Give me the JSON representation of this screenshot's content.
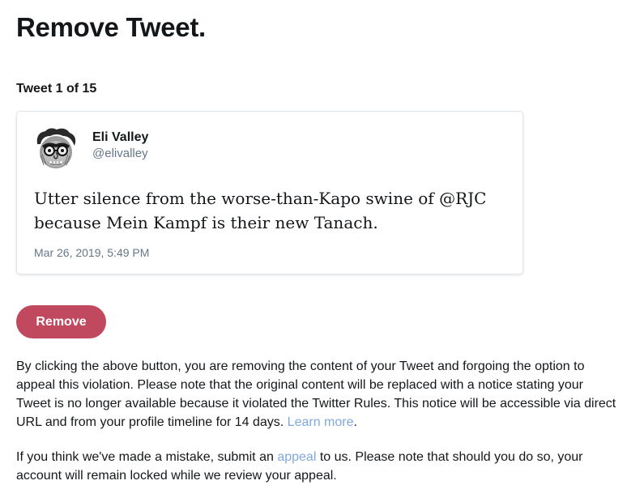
{
  "page": {
    "title": "Remove Tweet.",
    "counter": "Tweet 1 of 15"
  },
  "tweet": {
    "author_name": "Eli Valley",
    "author_handle": "@elivalley",
    "text_line1": "Utter silence from the worse-than-Kapo swine of @RJC",
    "text_line2": "because Mein Kampf is their new Tanach.",
    "date": "Mar 26, 2019, 5:49 PM",
    "avatar_icon": "caricature-avatar"
  },
  "actions": {
    "remove_label": "Remove",
    "accent_color": "#c0485f",
    "link_color": "#80a8e0"
  },
  "notice": {
    "para1_text": "By clicking the above button, you are removing the content of your Tweet and forgoing the option to appeal this violation. Please note that the original content will be replaced with a notice stating your Tweet is no longer available because it violated the Twitter Rules. This notice will be accessible via direct URL and from your profile timeline for 14 days.",
    "learn_more": "Learn more",
    "para1_end": ".",
    "para2_start": "If you think we've made a mistake, submit an",
    "appeal_link": "appeal",
    "para2_end": "to us. Please note that should you do so, your account will remain locked while we review your appeal."
  }
}
